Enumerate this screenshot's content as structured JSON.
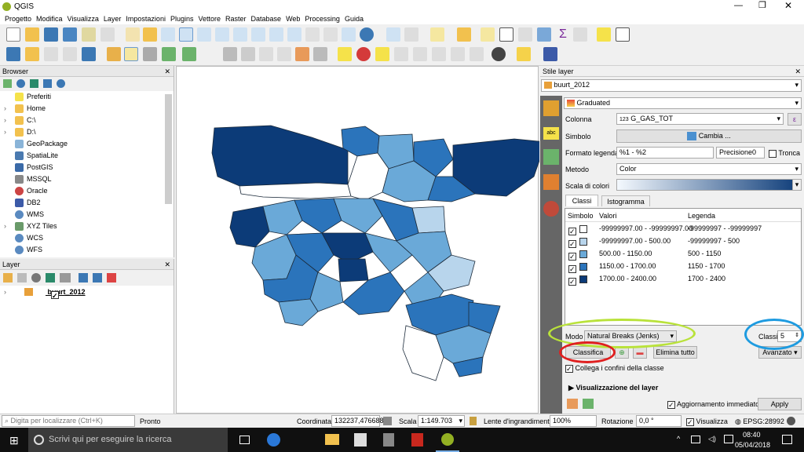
{
  "app": {
    "title": "QGIS"
  },
  "menu": [
    "Progetto",
    "Modifica",
    "Visualizza",
    "Layer",
    "Impostazioni",
    "Plugins",
    "Vettore",
    "Raster",
    "Database",
    "Web",
    "Processing",
    "Guida"
  ],
  "browser": {
    "title": "Browser",
    "items": [
      "Preferiti",
      "Home",
      "C:\\",
      "D:\\",
      "GeoPackage",
      "SpatiaLite",
      "PostGIS",
      "MSSQL",
      "Oracle",
      "DB2",
      "WMS",
      "XYZ Tiles",
      "WCS",
      "WFS"
    ]
  },
  "layers": {
    "title": "Layer",
    "items": [
      {
        "name": "buurt_2012",
        "checked": true
      }
    ]
  },
  "style": {
    "title": "Stile layer",
    "layer_name": "buurt_2012",
    "renderer": "Graduated",
    "column_label": "Colonna",
    "column_value": "G_GAS_TOT",
    "column_type": "123",
    "symbol_label": "Simbolo",
    "symbol_button": "Cambia ...",
    "legend_format_label": "Formato legenda",
    "legend_format_value": "%1 - %2",
    "precision_label": "Precisione",
    "precision_value": "0",
    "trim_label": "Tronca",
    "method_label": "Metodo",
    "method_value": "Color",
    "ramp_label": "Scala di colori",
    "tabs": [
      "Classi",
      "Istogramma"
    ],
    "headers": [
      "Simbolo",
      "Valori",
      "Legenda"
    ],
    "classes": [
      {
        "values": "-99999997.00 - -99999997.00",
        "legend": "-99999997 - -99999997",
        "color": "#ffffff"
      },
      {
        "values": "-99999997.00 - 500.00",
        "legend": "-99999997 - 500",
        "color": "#b8d5ec"
      },
      {
        "values": "500.00 - 1150.00",
        "legend": "500 - 1150",
        "color": "#6aa9d8"
      },
      {
        "values": "1150.00 - 1700.00",
        "legend": "1150 - 1700",
        "color": "#2b74bb"
      },
      {
        "values": "1700.00 - 2400.00",
        "legend": "1700 - 2400",
        "color": "#0c3b78"
      }
    ],
    "mode_label": "Modo",
    "mode_value": "Natural Breaks (Jenks)",
    "classes_label": "Classi",
    "classes_count": "5",
    "classify_button": "Classifica",
    "delete_all_button": "Elimina tutto",
    "advanced_button": "Avanzato",
    "link_bounds_label": "Collega i confini della classe",
    "layer_rendering_label": "Visualizzazione del layer",
    "live_update_label": "Aggiornamento immediato",
    "apply_button": "Apply"
  },
  "status": {
    "locator_placeholder": "Digita per localizzare (Ctrl+K)",
    "ready": "Pronto",
    "coord_label": "Coordinata",
    "coord_value": "132237,476688",
    "scale_label": "Scala",
    "scale_value": "1:149.703",
    "magnifier_label": "Lente d'ingrandimento",
    "magnifier_value": "100%",
    "rotation_label": "Rotazione",
    "rotation_value": "0,0 °",
    "render_label": "Visualizza",
    "crs": "EPSG:28992"
  },
  "taskbar": {
    "search_placeholder": "Scrivi qui per eseguire la ricerca",
    "time": "08:40",
    "date": "05/04/2018"
  },
  "colors": {
    "annotation_green": "#b9e23a",
    "annotation_blue": "#1e9be0",
    "annotation_red": "#e02020"
  }
}
